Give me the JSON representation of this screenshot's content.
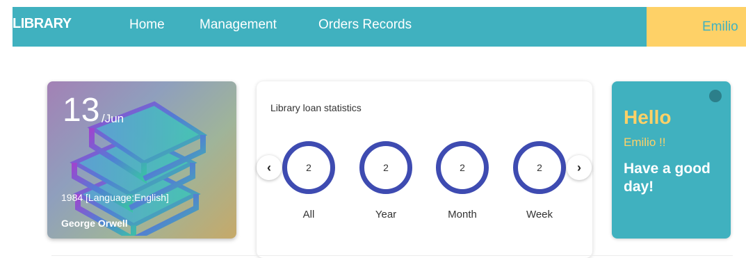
{
  "header": {
    "brand": "LIBRARY",
    "nav": {
      "home": "Home",
      "management": "Management",
      "orders": "Orders Records"
    },
    "user": "Emilio"
  },
  "book_card": {
    "day": "13",
    "month": "/Jun",
    "title": "1984 [Language:English]",
    "author": "George Orwell"
  },
  "stats": {
    "title": "Library loan statistics",
    "items": [
      {
        "label": "All",
        "value": "2"
      },
      {
        "label": "Year",
        "value": "2"
      },
      {
        "label": "Month",
        "value": "2"
      },
      {
        "label": "Week",
        "value": "2"
      }
    ],
    "prev_icon": "chevron-left-icon",
    "next_icon": "chevron-right-icon"
  },
  "greeting": {
    "hello": "Hello",
    "name": "Emilio !!",
    "message": "Have a good day!"
  },
  "colors": {
    "primary": "#40b1bf",
    "accent": "#fed167",
    "ring": "#3e4bb1"
  }
}
